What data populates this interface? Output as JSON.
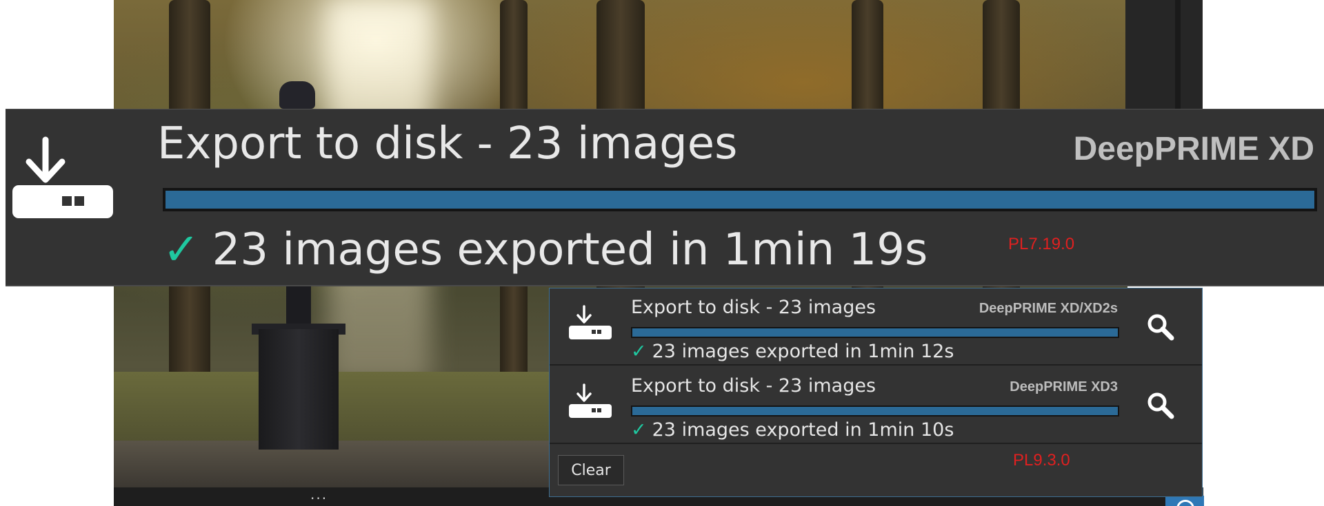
{
  "big_notification": {
    "title": "Export to disk - 23 images",
    "engine": "DeepPRIME XD",
    "progress": 1.0,
    "status_check": "✓",
    "status": "23 images exported in 1min 19s",
    "version_label": "PL7.19.0"
  },
  "notifications": [
    {
      "title": "Export to disk - 23 images",
      "engine": "DeepPRIME XD/XD2s",
      "progress": 1.0,
      "status_check": "✓",
      "status": "23 images exported in 1min 12s"
    },
    {
      "title": "Export to disk - 23 images",
      "engine": "DeepPRIME XD3",
      "progress": 1.0,
      "status_check": "✓",
      "status": "23 images exported in 1min 10s"
    }
  ],
  "clear_label": "Clear",
  "small_version_label": "PL9.3.0",
  "bottom_bar": {
    "more_dots": "..."
  },
  "colors": {
    "panel_bg": "#333333",
    "progress_fill": "#2b6a97",
    "check": "#1fc8a0",
    "version_text": "#e02020",
    "panel_border": "#3f6f92"
  },
  "icons": {
    "export": "export-to-disk-icon",
    "check": "check-icon",
    "search": "magnifier-icon"
  }
}
